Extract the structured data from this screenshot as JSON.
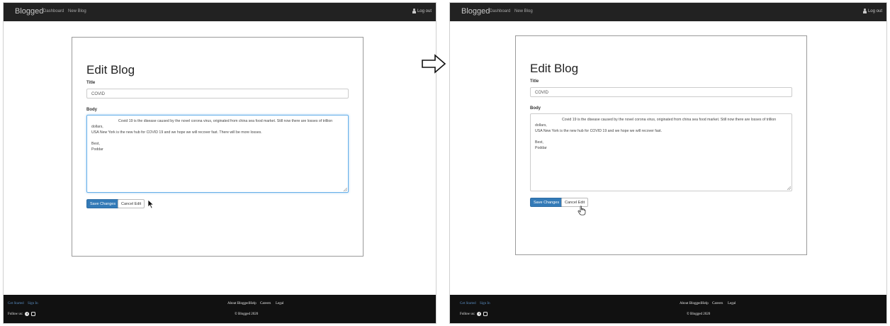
{
  "navbar": {
    "brand": "Blogged",
    "links": [
      "Dashboard",
      "New Blog"
    ],
    "logout": "Log out"
  },
  "form": {
    "heading": "Edit Blog",
    "title_label": "Title",
    "title_value": "COVID",
    "body_label": "Body",
    "body_line1": "Covid 19 is the disease caused by the novel corona virus, originated from china sea food market. Still now there are losses of trillion dollars,",
    "body_line2": "USA New York is the new hub for COVID 19 and we hope we will recover fast. There will be more losses.",
    "body_line2_after": "USA New York is the new hub for COVID 19 and we hope we will recover fast.",
    "sign_off_1": "Best,",
    "sign_off_2": "Poddar",
    "save_button": "Save Changes",
    "cancel_button": "Cancel Edit"
  },
  "footer": {
    "get_started": "Get Started",
    "sign_in": "Sign In",
    "follow_us": "Follow us:",
    "links": [
      "About Blogged",
      "Help",
      "Careers",
      "Legal"
    ],
    "copyright": "© Blogged 2020"
  },
  "colors": {
    "navbar_bg": "#222222",
    "footer_bg": "#111111",
    "primary_button": "#337ab7",
    "link_blue": "#5b8fc4"
  }
}
